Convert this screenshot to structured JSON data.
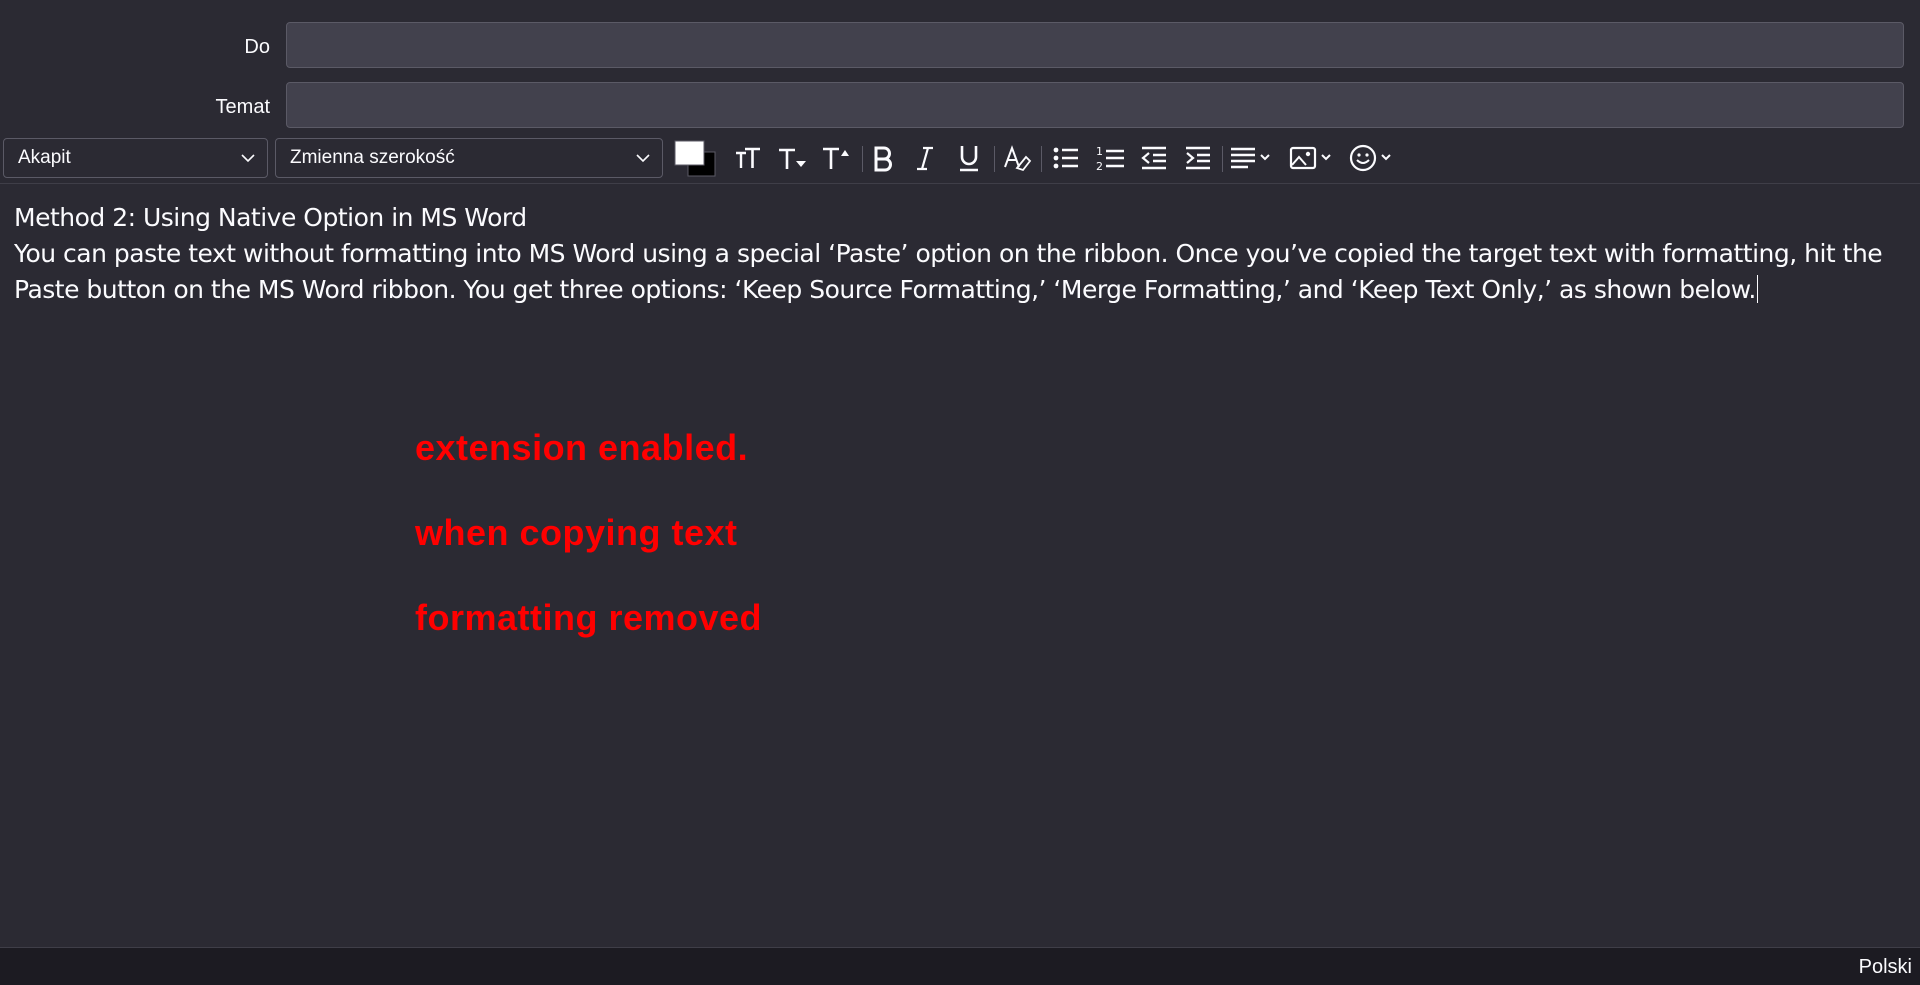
{
  "header": {
    "to_label": "Do",
    "to_value": "",
    "subject_label": "Temat",
    "subject_value": ""
  },
  "toolbar": {
    "paragraph_format": "Akapit",
    "font_family": "Zmienna szerokość",
    "text_color": "#ffffff",
    "background_color": "#000000",
    "buttons": [
      "reset-font-size",
      "decrease-font-size",
      "increase-font-size",
      "bold",
      "italic",
      "underline",
      "text-style",
      "bulleted-list",
      "numbered-list",
      "outdent",
      "indent",
      "align",
      "insert-image",
      "insert-emoji"
    ]
  },
  "editor": {
    "heading": "Method 2: Using Native Option in MS Word",
    "body": "You can paste text without formatting into MS Word using a special ‘Paste’ option on the ribbon. Once you’ve copied the target text with formatting, hit the Paste button on the MS Word ribbon. You get three options: ‘Keep Source Formatting,’ ‘Merge Formatting,’ and ‘Keep Text Only,’ as shown below."
  },
  "overlay": {
    "line1": "extension enabled.",
    "line2": "when copying text",
    "line3": "formatting removed",
    "color": "#ff0000"
  },
  "statusbar": {
    "language": "Polski"
  },
  "colors": {
    "background": "#2b2a33",
    "field": "#42414d",
    "statusbar": "#1c1b22",
    "spellcheck": "#e22850"
  }
}
